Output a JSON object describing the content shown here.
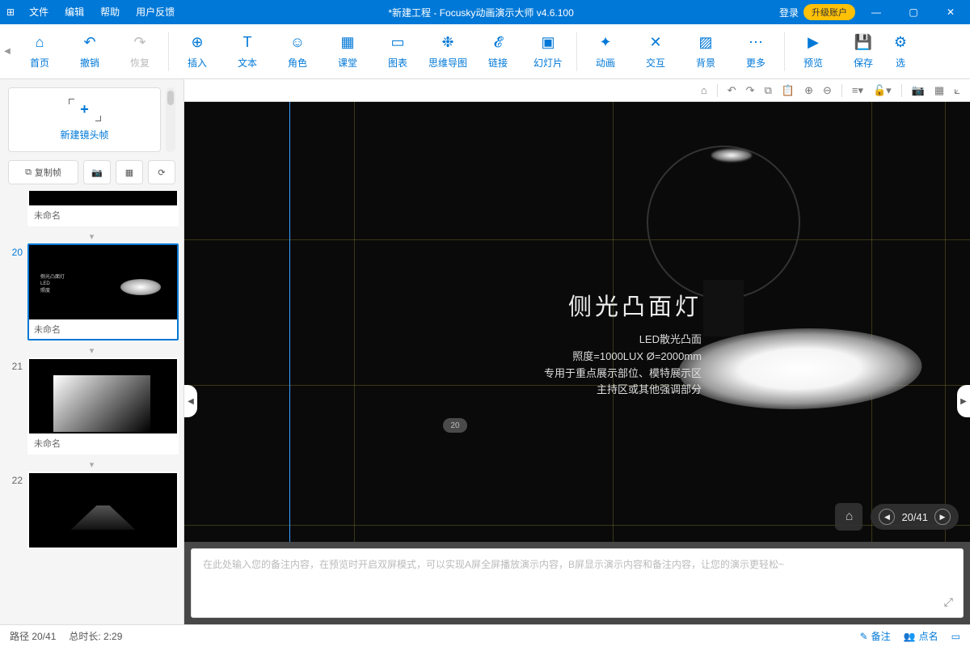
{
  "titlebar": {
    "menus": [
      "文件",
      "编辑",
      "帮助",
      "用户反馈"
    ],
    "title": "*新建工程 - Focusky动画演示大师  v4.6.100",
    "login": "登录",
    "upgrade": "升级账户"
  },
  "toolbar": {
    "home": "首页",
    "undo": "撤销",
    "redo": "恢复",
    "insert": "插入",
    "text": "文本",
    "role": "角色",
    "class": "课堂",
    "chart": "图表",
    "mindmap": "思维导图",
    "link": "链接",
    "slide": "幻灯片",
    "anim": "动画",
    "interact": "交互",
    "bg": "背景",
    "more": "更多",
    "preview": "预览",
    "save": "保存",
    "opt": "选"
  },
  "sidebar": {
    "newframe": "新建镜头帧",
    "copyframe": "复制帧",
    "thumbs": [
      {
        "num": "",
        "caption": "未命名",
        "partial": true
      },
      {
        "num": "20",
        "caption": "未命名",
        "active": true,
        "type": "spotlight"
      },
      {
        "num": "21",
        "caption": "未命名",
        "type": "panel"
      },
      {
        "num": "22",
        "caption": "",
        "type": "road"
      }
    ]
  },
  "canvas": {
    "badge": "20",
    "heading": "侧光凸面灯",
    "lines": [
      "LED散光凸面",
      "照度=1000LUX Ø=2000mm",
      "专用于重点展示部位、模特展示区",
      "主持区或其他强调部分"
    ],
    "page": "20/41"
  },
  "notes": {
    "placeholder": "在此处输入您的备注内容，在预览时开启双屏模式，可以实现A屏全屏播放演示内容，B屏显示演示内容和备注内容，让您的演示更轻松~"
  },
  "status": {
    "path": "路径 20/41",
    "duration": "总时长: 2:29",
    "note": "备注",
    "roll": "点名"
  }
}
